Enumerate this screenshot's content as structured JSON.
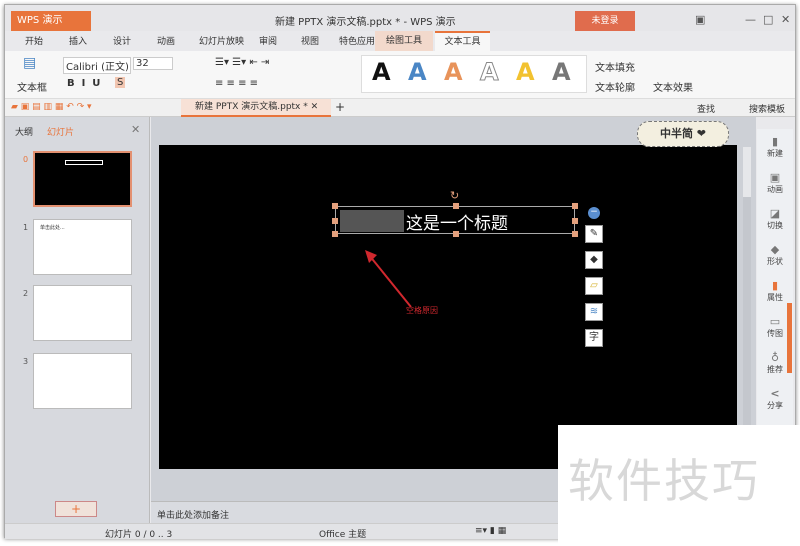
{
  "app": {
    "name": "WPS 演示",
    "title": "新建 PPTX 演示文稿.pptx * - WPS 演示",
    "login": "未登录"
  },
  "tabs": [
    "开始",
    "插入",
    "设计",
    "动画",
    "幻灯片放映",
    "审阅",
    "视图",
    "特色应用",
    "绘图工具",
    "文本工具"
  ],
  "ribbon": {
    "textbox": "文本框",
    "font": "Calibri (正文)",
    "size": "32",
    "fill": "文本填充",
    "outline": "文本轮廓",
    "effect": "文本效果",
    "art_colors": [
      "#111111",
      "#4a86c5",
      "#e8935a",
      "#ffffff",
      "#f2c230",
      "#777777"
    ]
  },
  "quick": {
    "doc_tab": "新建 PPTX 演示文稿.pptx *",
    "find": "查找",
    "search_template": "搜索模板"
  },
  "left_panel": {
    "tab_outline": "大纲",
    "tab_slides": "幻灯片",
    "slides": [
      {
        "num": "0"
      },
      {
        "num": "1",
        "text": "单击此处..."
      },
      {
        "num": "2"
      },
      {
        "num": "3"
      }
    ],
    "add": "+"
  },
  "slide": {
    "title": "这是一个标题",
    "annotation": "空格原因"
  },
  "sticker": "中半简 ❤",
  "right_bar": [
    "新建",
    "动画",
    "切换",
    "形状",
    "属性",
    "传图",
    "推荐",
    "分享"
  ],
  "notes": "单击此处添加备注",
  "status": {
    "slide": "幻灯片 0 / 0 .. 3",
    "theme": "Office 主题"
  },
  "watermark": "软件技巧"
}
